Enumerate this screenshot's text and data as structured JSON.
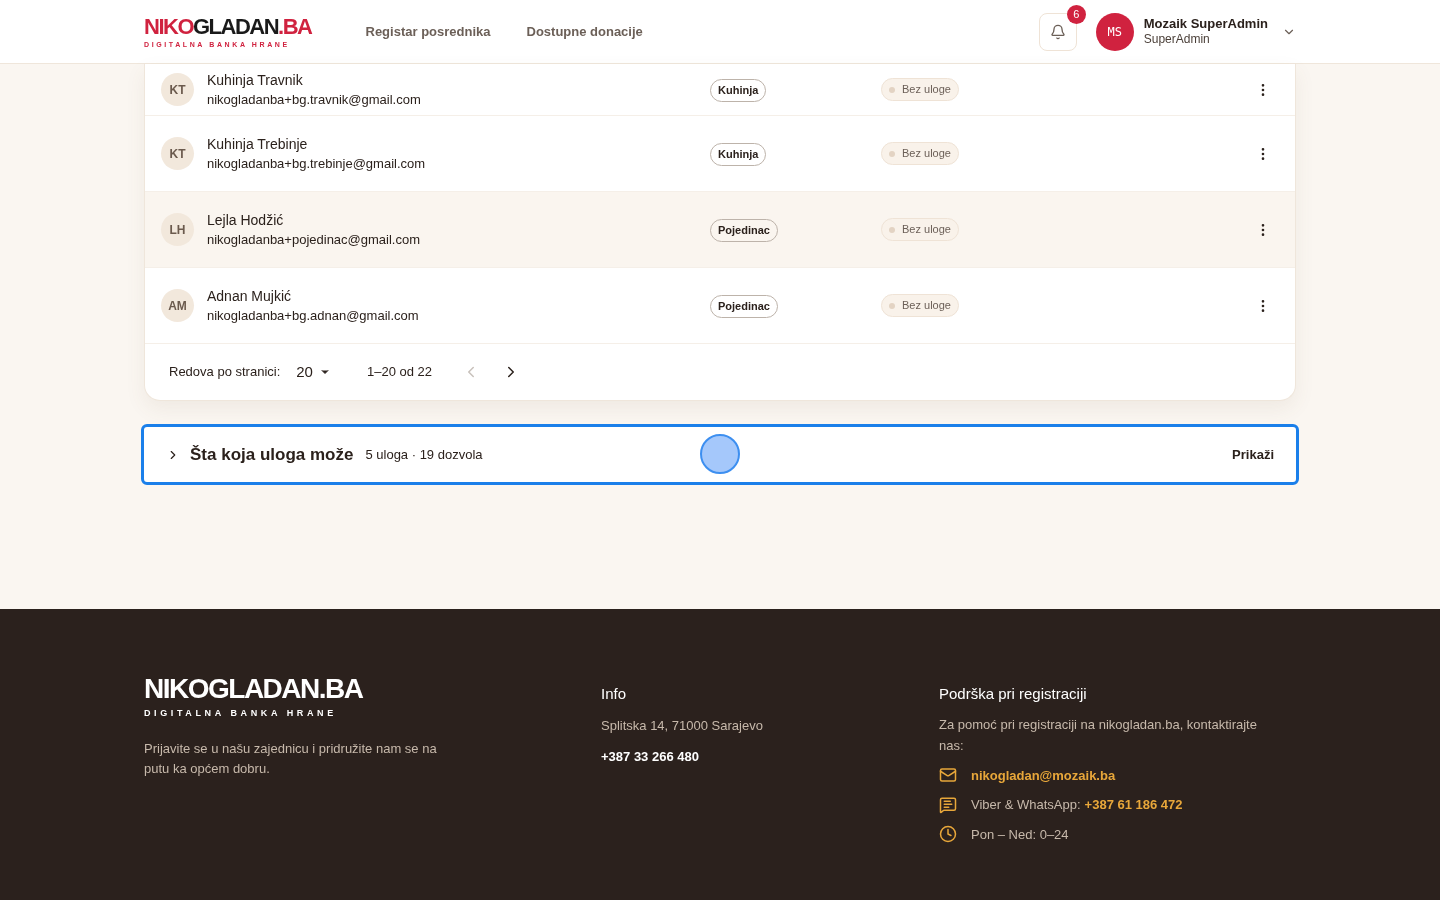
{
  "header": {
    "logo": {
      "part_1": "NIKO",
      "part_2": "GLADAN",
      "part_3": ".BA",
      "tagline": "DIGITALNA BANKA HRANE"
    },
    "nav": [
      "Registar posrednika",
      "Dostupne donacije"
    ],
    "notifications": "6",
    "user": {
      "initials": "MS",
      "name": "Mozaik SuperAdmin",
      "role": "SuperAdmin"
    }
  },
  "users": [
    {
      "initials": "KT",
      "name": "Kuhinja Travnik",
      "email": "nikogladanba+bg.travnik@gmail.com",
      "type": "Kuhinja",
      "role": "Bez uloge",
      "hovered": false
    },
    {
      "initials": "KT",
      "name": "Kuhinja Trebinje",
      "email": "nikogladanba+bg.trebinje@gmail.com",
      "type": "Kuhinja",
      "role": "Bez uloge",
      "hovered": false
    },
    {
      "initials": "LH",
      "name": "Lejla Hodžić",
      "email": "nikogladanba+pojedinac@gmail.com",
      "type": "Pojedinac",
      "role": "Bez uloge",
      "hovered": true
    },
    {
      "initials": "AM",
      "name": "Adnan Mujkić",
      "email": "nikogladanba+bg.adnan@gmail.com",
      "type": "Pojedinac",
      "role": "Bez uloge",
      "hovered": false
    }
  ],
  "pagination": {
    "label": "Redova po stranici:",
    "per_page": "20",
    "range": "1–20 od 22",
    "prev_disabled": true,
    "next_disabled": false
  },
  "roles_panel": {
    "title": "Šta koja uloga može",
    "summary": "5 uloga · 19 dozvola",
    "action": "Prikaži",
    "expanded": false,
    "focused": true
  },
  "footer": {
    "logo": {
      "name": "NIKOGLADAN.BA",
      "tagline": "DIGITALNA BANKA HRANE"
    },
    "about": "Prijavite se u našu zajednicu i pridružite nam se na putu ka općem dobru.",
    "info": {
      "title": "Info",
      "address": "Splitska 14, 71000 Sarajevo",
      "phone": "+387 33 266 480"
    },
    "support": {
      "title": "Podrška pri registraciji",
      "text": "Za pomoć pri registraciji na nikogladan.ba, kontaktirajte nas:",
      "contacts": [
        {
          "kind": "email",
          "value": "nikogladan@mozaik.ba"
        },
        {
          "kind": "chat",
          "label": "Viber & WhatsApp:",
          "value": "+387 61 186 472"
        },
        {
          "kind": "hours",
          "value": "Pon – Ned: 0–24"
        }
      ]
    }
  }
}
